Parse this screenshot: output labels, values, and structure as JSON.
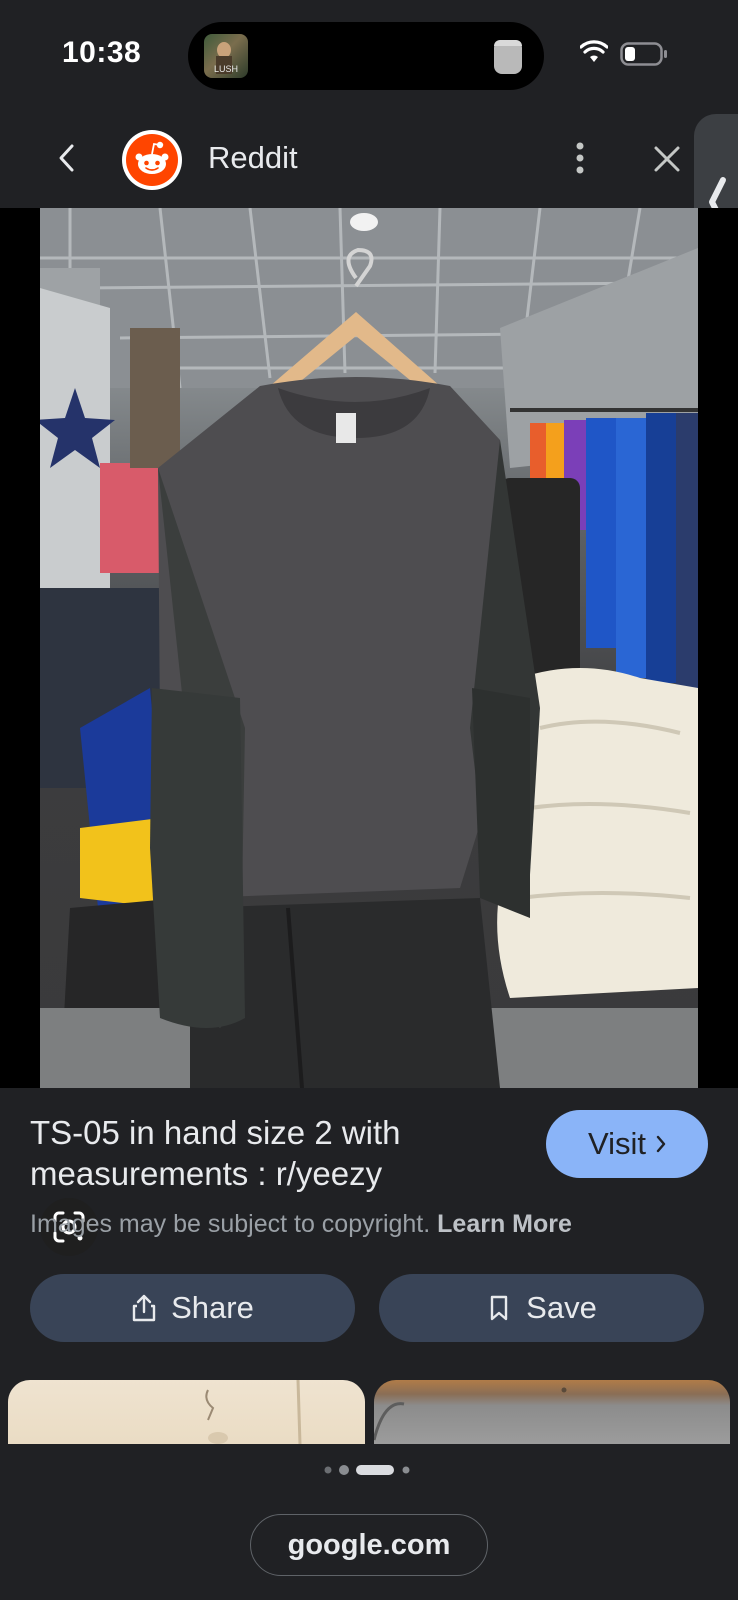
{
  "status_bar": {
    "time": "10:38",
    "now_playing_art_text": "LUSH"
  },
  "app_bar": {
    "site_name": "Reddit",
    "icons": [
      "back-icon",
      "reddit-logo",
      "more-vert-icon",
      "close-icon",
      "chevron-left-icon"
    ]
  },
  "result": {
    "title": "TS-05 in hand size 2 with measurements : r/yeezy",
    "visit_label": "Visit",
    "copyright_text": "Images may be subject to copyright.",
    "learn_more_label": "Learn More",
    "share_label": "Share",
    "save_label": "Save"
  },
  "footer": {
    "url": "google.com"
  },
  "colors": {
    "background": "#202124",
    "visit_button": "#8ab4f8",
    "action_button": "#394457",
    "reddit_orange": "#ff4500"
  }
}
